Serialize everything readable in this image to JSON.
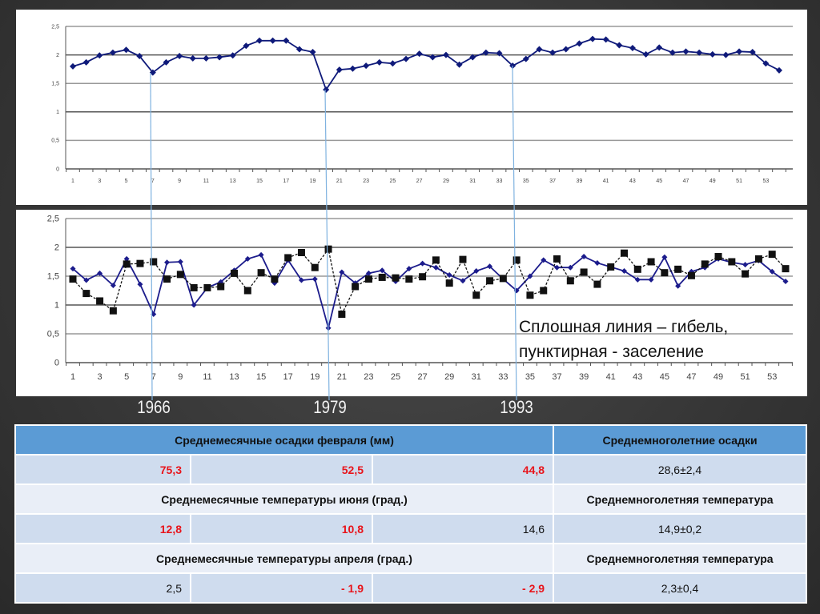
{
  "chart_data": [
    {
      "type": "line",
      "title": "",
      "xlabel": "",
      "ylabel": "",
      "ylim": [
        0,
        2.5
      ],
      "yticks": [
        "0",
        "0,5",
        "1",
        "1,5",
        "2",
        "2,5"
      ],
      "xticks": [
        "1",
        "3",
        "5",
        "7",
        "9",
        "11",
        "13",
        "15",
        "17",
        "19",
        "21",
        "23",
        "25",
        "27",
        "29",
        "31",
        "33",
        "35",
        "37",
        "39",
        "41",
        "43",
        "45",
        "47",
        "49",
        "51",
        "53"
      ],
      "grid": true,
      "series": [
        {
          "name": "",
          "color": "#0f1a7a",
          "marker": "diamond",
          "values": [
            1.8,
            1.87,
            1.99,
            2.04,
            2.09,
            1.98,
            1.69,
            1.87,
            1.98,
            1.94,
            1.94,
            1.96,
            1.99,
            2.16,
            2.25,
            2.25,
            2.25,
            2.1,
            2.05,
            1.39,
            1.74,
            1.76,
            1.81,
            1.87,
            1.85,
            1.93,
            2.02,
            1.96,
            2.0,
            1.83,
            1.96,
            2.04,
            2.03,
            1.81,
            1.93,
            2.1,
            2.04,
            2.1,
            2.2,
            2.28,
            2.27,
            2.17,
            2.12,
            2.01,
            2.13,
            2.04,
            2.06,
            2.04,
            2.01,
            2.0,
            2.06,
            2.05,
            1.85,
            1.73
          ]
        }
      ]
    },
    {
      "type": "line",
      "title": "",
      "xlabel": "",
      "ylabel": "",
      "ylim": [
        0,
        2.5
      ],
      "yticks": [
        "0",
        "0,5",
        "1",
        "1,5",
        "2",
        "2,5"
      ],
      "xticks": [
        "1",
        "3",
        "5",
        "7",
        "9",
        "11",
        "13",
        "15",
        "17",
        "19",
        "21",
        "23",
        "25",
        "27",
        "29",
        "31",
        "33",
        "35",
        "37",
        "39",
        "41",
        "43",
        "45",
        "47",
        "49",
        "51",
        "53"
      ],
      "grid": true,
      "annotation": [
        "Сплошная линия – гибель,",
        "пунктирная - заселение"
      ],
      "series": [
        {
          "name": "гибель",
          "style": "solid",
          "color": "#1c1c8c",
          "marker": "diamond",
          "values": [
            1.63,
            1.43,
            1.55,
            1.34,
            1.8,
            1.36,
            0.84,
            1.74,
            1.75,
            1.0,
            1.3,
            1.4,
            1.6,
            1.8,
            1.87,
            1.38,
            1.78,
            1.43,
            1.45,
            0.6,
            1.57,
            1.38,
            1.55,
            1.6,
            1.41,
            1.63,
            1.72,
            1.65,
            1.52,
            1.42,
            1.59,
            1.67,
            1.45,
            1.25,
            1.5,
            1.78,
            1.65,
            1.65,
            1.84,
            1.73,
            1.66,
            1.59,
            1.44,
            1.44,
            1.83,
            1.33,
            1.58,
            1.65,
            1.8,
            1.74,
            1.7,
            1.77,
            1.58,
            1.41
          ]
        },
        {
          "name": "заселение",
          "style": "dashed",
          "color": "#111111",
          "marker": "square",
          "values": [
            1.45,
            1.2,
            1.07,
            0.9,
            1.71,
            1.72,
            1.75,
            1.45,
            1.53,
            1.3,
            1.3,
            1.32,
            1.55,
            1.25,
            1.56,
            1.45,
            1.82,
            1.91,
            1.65,
            1.97,
            0.84,
            1.32,
            1.45,
            1.48,
            1.47,
            1.45,
            1.49,
            1.78,
            1.38,
            1.79,
            1.17,
            1.42,
            1.46,
            1.78,
            1.17,
            1.25,
            1.8,
            1.42,
            1.57,
            1.36,
            1.66,
            1.9,
            1.62,
            1.75,
            1.56,
            1.62,
            1.51,
            1.71,
            1.84,
            1.75,
            1.54,
            1.8,
            1.88,
            1.63
          ]
        }
      ]
    }
  ],
  "markers": [
    {
      "year": "1966",
      "x_index": 7
    },
    {
      "year": "1979",
      "x_index": 20
    },
    {
      "year": "1993",
      "x_index": 34
    }
  ],
  "line_color": "#7fb2e0",
  "table": {
    "rows": [
      {
        "kind": "head",
        "left": "Среднемесячные осадки февраля (мм)",
        "right": "Среднемноголетние осадки"
      },
      {
        "kind": "values",
        "cells": [
          {
            "text": "75,3",
            "highlight": true
          },
          {
            "text": "52,5",
            "highlight": true
          },
          {
            "text": "44,8",
            "highlight": true
          }
        ],
        "right": "28,6±2,4"
      },
      {
        "kind": "subhead",
        "left": "Среднемесячные температуры июня (град.)",
        "right": "Среднемноголетняя температура"
      },
      {
        "kind": "values",
        "cells": [
          {
            "text": "12,8",
            "highlight": true
          },
          {
            "text": "10,8",
            "highlight": true
          },
          {
            "text": "14,6",
            "highlight": false
          }
        ],
        "right": "14,9±0,2"
      },
      {
        "kind": "subhead",
        "left": "Среднемесячные температуры апреля (град.)",
        "right": "Среднемноголетняя температура"
      },
      {
        "kind": "values",
        "cells": [
          {
            "text": "2,5",
            "highlight": false
          },
          {
            "text": "- 1,9",
            "highlight": true
          },
          {
            "text": "- 2,9",
            "highlight": true
          }
        ],
        "right": "2,3±0,4"
      }
    ]
  }
}
